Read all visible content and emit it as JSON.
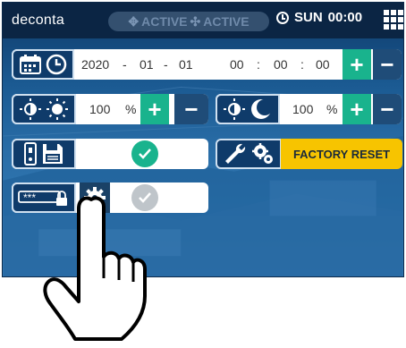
{
  "header": {
    "brand": "deconta",
    "status_1": "ACTIVE",
    "status_2": "ACTIVE",
    "day": "SUN",
    "time": "00:00"
  },
  "datetime": {
    "year": "2020",
    "month": "01",
    "day": "01",
    "hour": "00",
    "minute": "00",
    "second": "00",
    "date_sep": "-",
    "time_sep": ":"
  },
  "brightness_day": {
    "value": "100",
    "unit": "%"
  },
  "brightness_night": {
    "value": "100",
    "unit": "%"
  },
  "buttons": {
    "plus": "+",
    "minus": "−"
  },
  "factory_reset": {
    "label": "FACTORY RESET"
  },
  "password": {
    "masked": "***"
  },
  "colors": {
    "accent_green": "#19b38d",
    "minus_blue": "#1f4c78",
    "factory_yellow": "#f7c400",
    "topbar": "#0b2544"
  }
}
